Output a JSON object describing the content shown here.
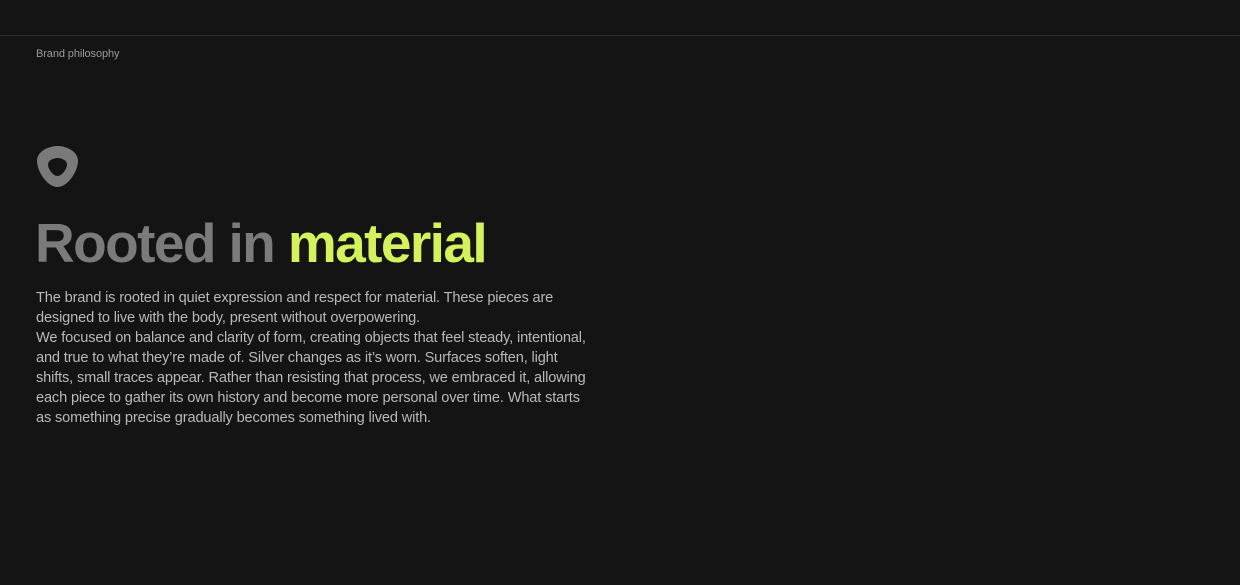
{
  "colors": {
    "background": "#141414",
    "divider": "#2e2e2e",
    "label": "#9a9a9a",
    "headline_muted": "#7b7b7b",
    "accent": "#d4f25c",
    "body": "#b9b9b9",
    "logo": "#7a7a7a"
  },
  "header": {
    "section_label": "Brand philosophy"
  },
  "logo": {
    "icon": "rounded-triangle-ring-icon"
  },
  "headline": {
    "muted": "Rooted in",
    "accent": "material"
  },
  "body": {
    "paragraph_1": "The brand is rooted in quiet expression and respect for material. These pieces are designed to live with the body, present without overpowering.",
    "paragraph_2": "We focused on balance and clarity of form, creating objects that feel steady, intentional, and true to what they’re made of. Silver changes as it’s worn. Surfaces soften, light shifts, small traces appear. Rather than resisting that process, we embraced it, allowing each piece to gather its own history and become more personal over time. What starts as something precise gradually becomes something lived with."
  }
}
